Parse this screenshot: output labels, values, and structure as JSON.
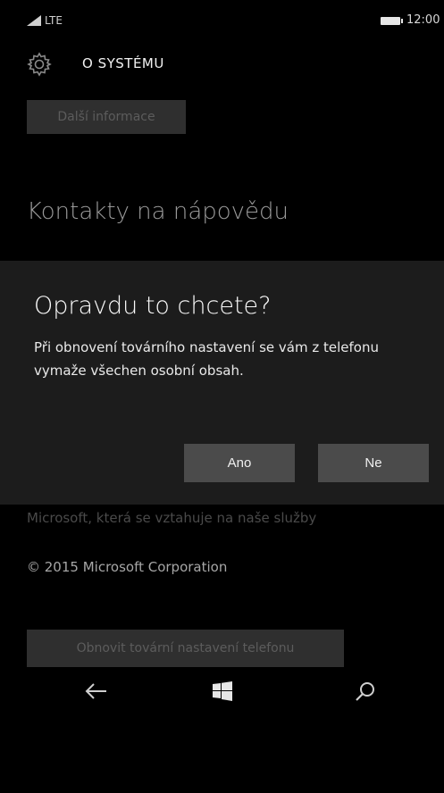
{
  "status_bar": {
    "network": "LTE",
    "time": "12:00"
  },
  "header": {
    "title": "O SYSTÉMU"
  },
  "background": {
    "more_info_button": "Další informace",
    "help_heading": "Kontakty na nápovědu",
    "microsoft_text": "Microsoft, která se vztahuje na naše služby",
    "copyright": "© 2015 Microsoft Corporation",
    "reset_button": "Obnovit tovární nastavení telefonu"
  },
  "dialog": {
    "title": "Opravdu to chcete?",
    "message": "Při obnovení továrního nastavení se vám z telefonu vymaže všechen osobní obsah.",
    "yes_label": "Ano",
    "no_label": "Ne"
  },
  "nav": {
    "back_icon": "back-arrow-icon",
    "home_icon": "windows-logo-icon",
    "search_icon": "search-icon"
  },
  "colors": {
    "background": "#000000",
    "dialog": "#1c1c1c",
    "dialog_button": "#4b4b4b",
    "dim_button": "#2f2f2f"
  }
}
